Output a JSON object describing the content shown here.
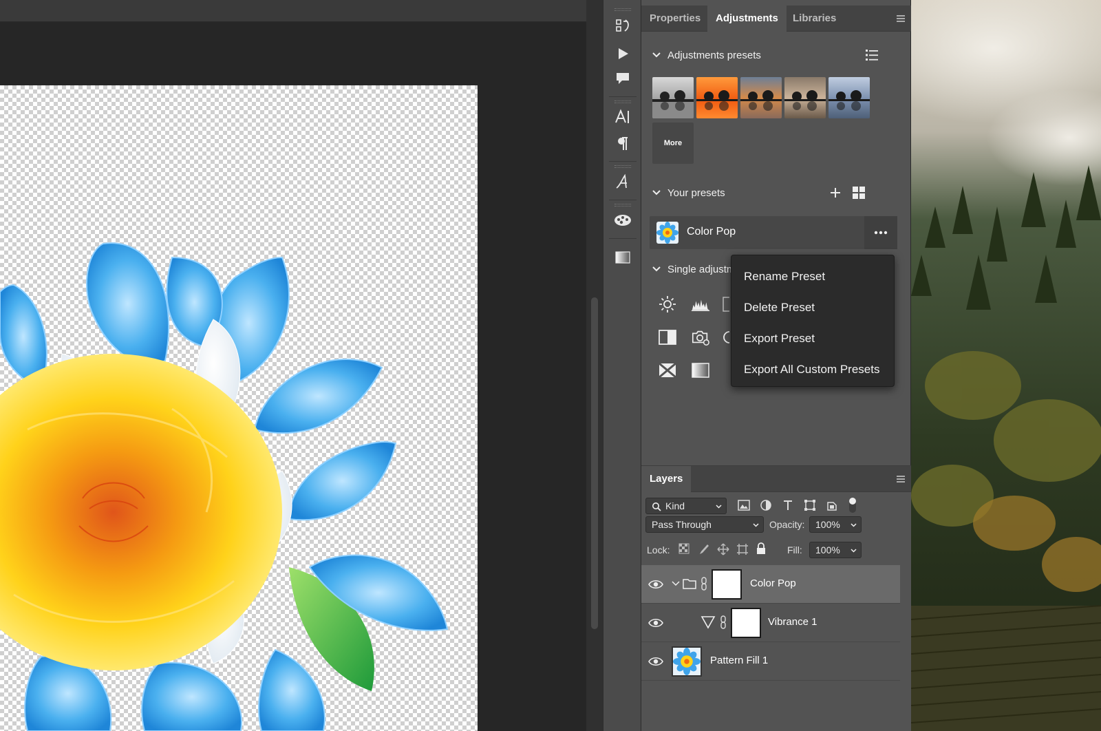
{
  "panel_tabs": [
    {
      "label": "Properties",
      "active": false
    },
    {
      "label": "Adjustments",
      "active": true
    },
    {
      "label": "Libraries",
      "active": false
    }
  ],
  "adjustments_presets": {
    "title": "Adjustments presets",
    "more_label": "More"
  },
  "your_presets": {
    "title": "Your presets",
    "items": [
      {
        "label": "Color Pop"
      }
    ]
  },
  "single_adjustments": {
    "title_visible": "Single adjustm"
  },
  "context_menu": {
    "items": [
      {
        "label": "Rename Preset"
      },
      {
        "label": "Delete Preset"
      },
      {
        "label": "Export Preset"
      },
      {
        "label": "Export All Custom Presets"
      }
    ]
  },
  "layers": {
    "tab_label": "Layers",
    "filter_kind": "Kind",
    "blend_mode": "Pass Through",
    "opacity_label": "Opacity:",
    "opacity_value": "100%",
    "lock_label": "Lock:",
    "fill_label": "Fill:",
    "fill_value": "100%",
    "rows": [
      {
        "name": "Color Pop",
        "selected": true
      },
      {
        "name": "Vibrance 1",
        "selected": false
      },
      {
        "name": "Pattern Fill 1",
        "selected": false
      }
    ]
  },
  "colors": {
    "panel_bg": "#535353",
    "menu_bg": "#2b2b2b",
    "selected_row": "#6a6a6a"
  }
}
